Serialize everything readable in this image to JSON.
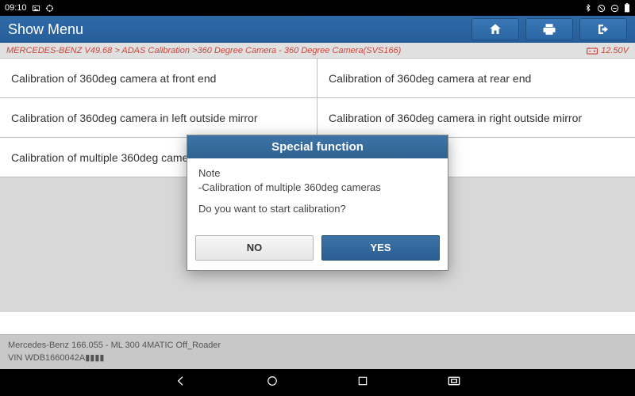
{
  "statusbar": {
    "time": "09:10"
  },
  "header": {
    "title": "Show Menu"
  },
  "breadcrumb": {
    "path": "MERCEDES-BENZ V49.68 > ADAS Calibration >360 Degree  Camera - 360 Degree  Camera(SVS166)",
    "voltage": "12.50V"
  },
  "grid": {
    "items": [
      "Calibration of 360deg camera at front end",
      "Calibration of 360deg camera at rear end",
      "Calibration of 360deg camera in left outside mirror",
      "Calibration of 360deg camera in right outside mirror",
      "Calibration of multiple 360deg cameras",
      ""
    ]
  },
  "footer": {
    "line1": "Mercedes-Benz 166.055 - ML 300 4MATIC Off_Roader",
    "line2": "VIN WDB1660042A▮▮▮▮"
  },
  "dialog": {
    "title": "Special function",
    "note_label": "Note",
    "note_line": "-Calibration of multiple 360deg cameras",
    "question": "Do you want to start calibration?",
    "no": "NO",
    "yes": "YES"
  }
}
